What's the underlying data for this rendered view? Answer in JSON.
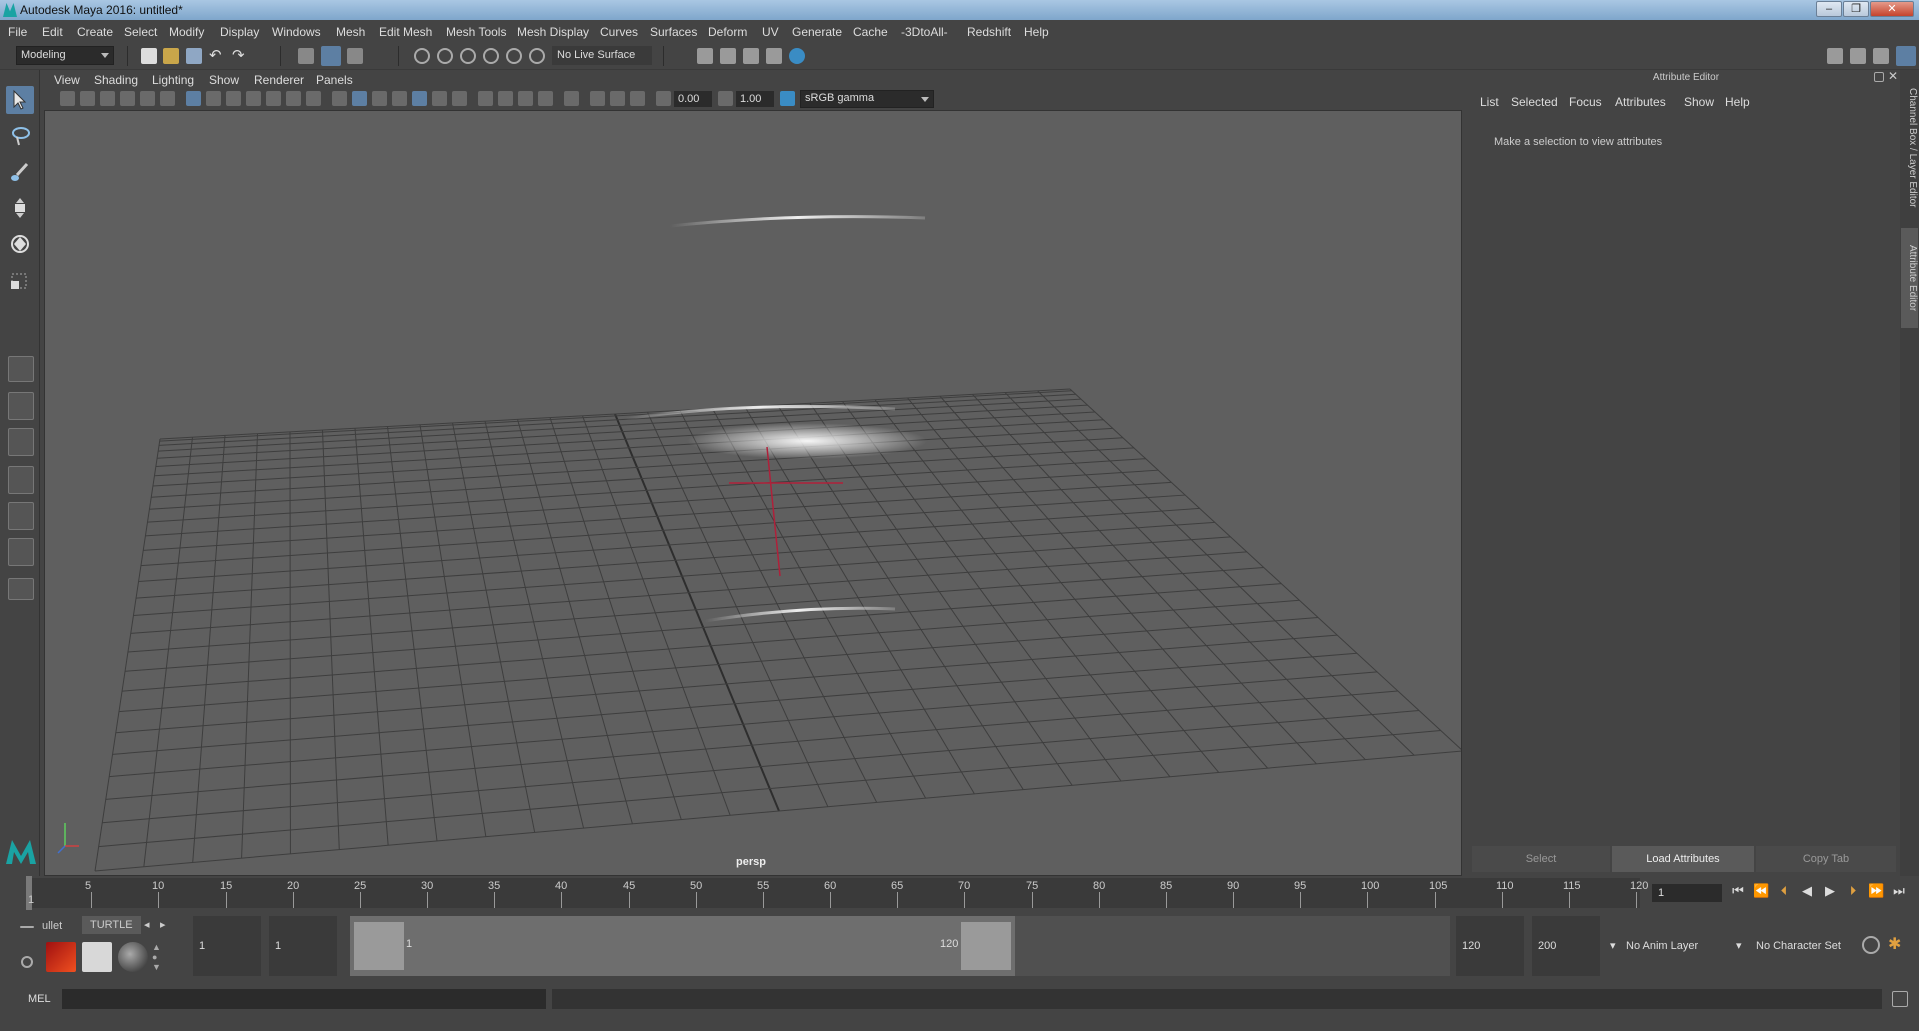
{
  "window": {
    "title": "Autodesk Maya 2016: untitled*",
    "buttons": [
      "–",
      "❐",
      "✕"
    ]
  },
  "menubar": {
    "items": [
      "File",
      "Edit",
      "Create",
      "Select",
      "Modify",
      "Display",
      "Windows",
      "Mesh",
      "Edit Mesh",
      "Mesh Tools",
      "Mesh Display",
      "Curves",
      "Surfaces",
      "Deform",
      "UV",
      "Generate",
      "Cache",
      "-3DtoAll-",
      "Redshift",
      "Help"
    ]
  },
  "statusline": {
    "menuset": "Modeling",
    "live_surface": "No Live Surface"
  },
  "viewport": {
    "menu": [
      "View",
      "Shading",
      "Lighting",
      "Show",
      "Renderer",
      "Panels"
    ],
    "exposure": "0.00",
    "gamma": "1.00",
    "color_space": "sRGB gamma",
    "camera_label": "persp"
  },
  "attribute_editor": {
    "title": "Attribute Editor",
    "menu": [
      "List",
      "Selected",
      "Focus",
      "Attributes",
      "Show",
      "Help"
    ],
    "message": "Make a selection to view attributes",
    "buttons": [
      "Select",
      "Load Attributes",
      "Copy Tab"
    ]
  },
  "side_tabs": [
    "Channel Box / Layer Editor",
    "Attribute Editor"
  ],
  "timeslider": {
    "ticks": [
      "5",
      "10",
      "15",
      "20",
      "25",
      "30",
      "35",
      "40",
      "45",
      "50",
      "55",
      "60",
      "65",
      "70",
      "75",
      "80",
      "85",
      "90",
      "95",
      "100",
      "105",
      "110",
      "115",
      "120"
    ],
    "start_marker": "1",
    "current_frame": "1"
  },
  "range": {
    "anim_start": "1",
    "playback_start": "1",
    "range_start_label": "1",
    "range_end_label": "120",
    "playback_end": "120",
    "anim_end": "200",
    "anim_layer": "No Anim Layer",
    "character_set": "No Character Set"
  },
  "shelf": {
    "tabs": [
      "ullet",
      "TURTLE"
    ]
  },
  "cmdline": {
    "label": "MEL"
  },
  "colors": {
    "accent": "#5d7fa3",
    "viewport_bg": "#5f5f5f",
    "grid": "#3a3a3a",
    "manipulator": "#b0203a"
  }
}
